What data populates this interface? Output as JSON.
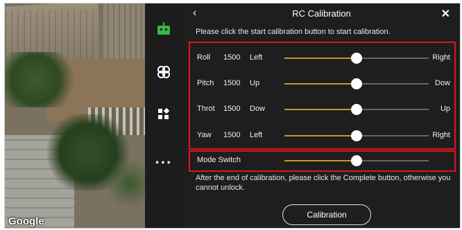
{
  "map": {
    "attribution": "Google"
  },
  "sidebar": {
    "items": [
      {
        "icon": "robot-icon"
      },
      {
        "icon": "drone-icon"
      },
      {
        "icon": "widgets-icon"
      },
      {
        "icon": "more-icon"
      }
    ]
  },
  "header": {
    "back": "‹",
    "title": "RC Calibration",
    "close": "✕"
  },
  "instruction": "Please click the start calibration button to start calibration.",
  "channels": [
    {
      "name": "Roll",
      "value": "1500",
      "min_label": "Left",
      "max_label": "Right",
      "position": 0.5
    },
    {
      "name": "Pitch",
      "value": "1500",
      "min_label": "Up",
      "max_label": "Dow",
      "position": 0.5
    },
    {
      "name": "Throt",
      "value": "1500",
      "min_label": "Dow",
      "max_label": "Up",
      "position": 0.5
    },
    {
      "name": "Yaw",
      "value": "1500",
      "min_label": "Left",
      "max_label": "Right",
      "position": 0.5
    }
  ],
  "mode_switch": {
    "name": "Mode Switch",
    "position": 0.5
  },
  "note": "After the end of calibration, please click the Complete button, otherwise you cannot unlock.",
  "calibration_button": "Calibration",
  "colors": {
    "highlight": "#e0141b",
    "track_active": "#c7962a",
    "device_icon": "#39b54a"
  }
}
